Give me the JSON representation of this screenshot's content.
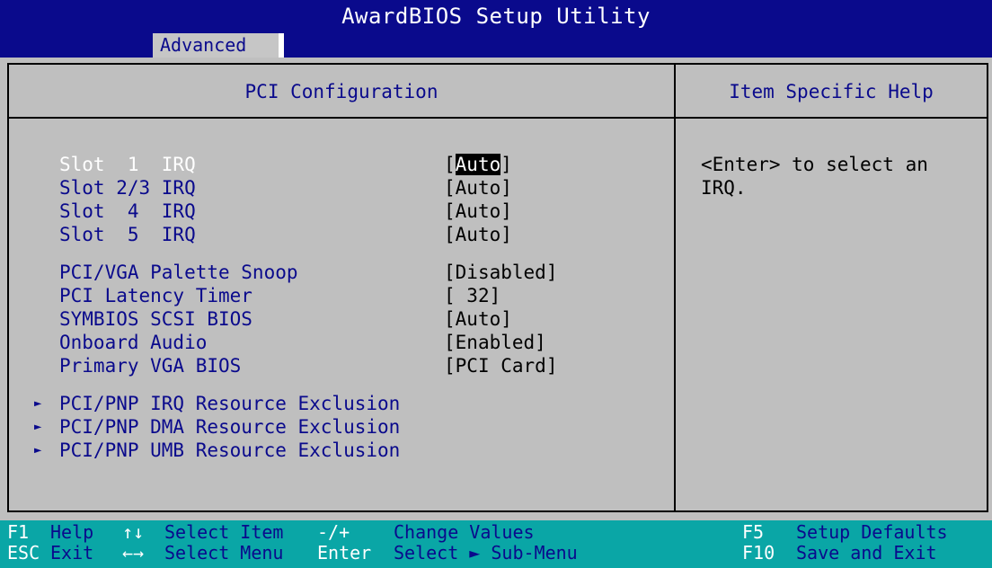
{
  "title": "AwardBIOS Setup Utility",
  "menu": {
    "active_tab": "Advanced"
  },
  "panel": {
    "title": "PCI Configuration",
    "help_title": "Item Specific Help",
    "help_text": "<Enter> to select an IRQ."
  },
  "items": [
    {
      "label": "Slot  1  IRQ",
      "value": "Auto",
      "selected": true
    },
    {
      "label": "Slot 2/3 IRQ",
      "value": "Auto"
    },
    {
      "label": "Slot  4  IRQ",
      "value": "Auto"
    },
    {
      "label": "Slot  5  IRQ",
      "value": "Auto"
    },
    {
      "label": "PCI/VGA Palette Snoop",
      "value": "Disabled"
    },
    {
      "label": "PCI Latency Timer",
      "value": " 32"
    },
    {
      "label": "SYMBIOS SCSI BIOS",
      "value": "Auto"
    },
    {
      "label": "Onboard Audio",
      "value": "Enabled"
    },
    {
      "label": "Primary VGA BIOS",
      "value": "PCI Card"
    }
  ],
  "submenus": [
    "PCI/PNP IRQ Resource Exclusion",
    "PCI/PNP DMA Resource Exclusion",
    "PCI/PNP UMB Resource Exclusion"
  ],
  "footer": {
    "f1_key": "F1",
    "f1_desc": "Help",
    "updown_key": "↑↓",
    "updown_desc": "Select Item",
    "plusminus_key": "-/+",
    "plusminus_desc": "Change Values",
    "f5_key": "F5",
    "f5_desc": "Setup Defaults",
    "esc_key": "ESC",
    "esc_desc": "Exit",
    "leftright_key": "←→",
    "leftright_desc": "Select Menu",
    "enter_key": "Enter",
    "enter_desc": "Select ► Sub-Menu",
    "f10_key": "F10",
    "f10_desc": "Save and Exit"
  },
  "colors": {
    "title_bg": "#0a0a8c",
    "panel_bg": "#bfbfbf",
    "footer_bg": "#0aa6a6",
    "label_text": "#0a0a8c",
    "value_text": "#000000",
    "highlight_bg": "#000000",
    "highlight_text": "#ffffff"
  },
  "icons": {
    "submenu": "triangle-right-icon"
  }
}
